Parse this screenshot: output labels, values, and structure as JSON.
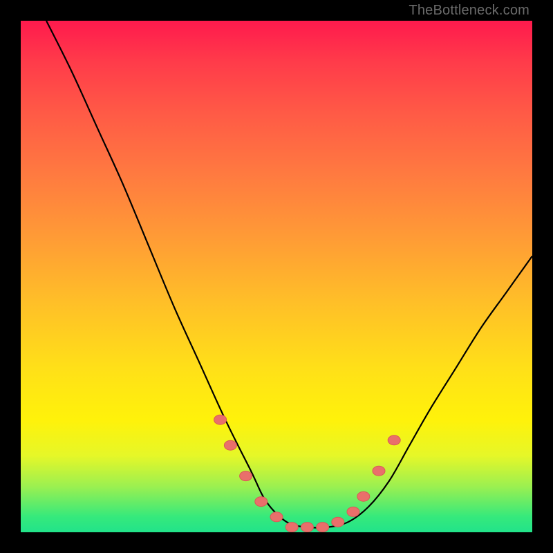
{
  "watermark": "TheBottleneck.com",
  "colors": {
    "frame": "#000000",
    "gradient_top": "#ff1a4d",
    "gradient_bottom": "#22e38a",
    "curve_stroke": "#000000",
    "marker_fill": "#e96f6b",
    "marker_stroke": "#d85a56"
  },
  "chart_data": {
    "type": "line",
    "title": "",
    "xlabel": "",
    "ylabel": "",
    "xlim": [
      0,
      100
    ],
    "ylim": [
      0,
      100
    ],
    "note": "No axis ticks or numeric labels are rendered; values are estimated from pixel positions on a normalized 0-100 scale where y=0 is the bottom (green) and y=100 is the top (red).",
    "series": [
      {
        "name": "bottleneck-curve",
        "x": [
          5,
          10,
          15,
          20,
          25,
          30,
          35,
          40,
          45,
          48,
          52,
          56,
          60,
          64,
          68,
          72,
          76,
          80,
          85,
          90,
          95,
          100
        ],
        "y": [
          100,
          90,
          79,
          68,
          56,
          44,
          33,
          22,
          12,
          6,
          2,
          1,
          1,
          2,
          5,
          10,
          17,
          24,
          32,
          40,
          47,
          54
        ]
      }
    ],
    "markers": {
      "name": "highlighted-points",
      "x": [
        39,
        41,
        44,
        47,
        50,
        53,
        56,
        59,
        62,
        65,
        67,
        70,
        73
      ],
      "y": [
        22,
        17,
        11,
        6,
        3,
        1,
        1,
        1,
        2,
        4,
        7,
        12,
        18
      ]
    }
  }
}
